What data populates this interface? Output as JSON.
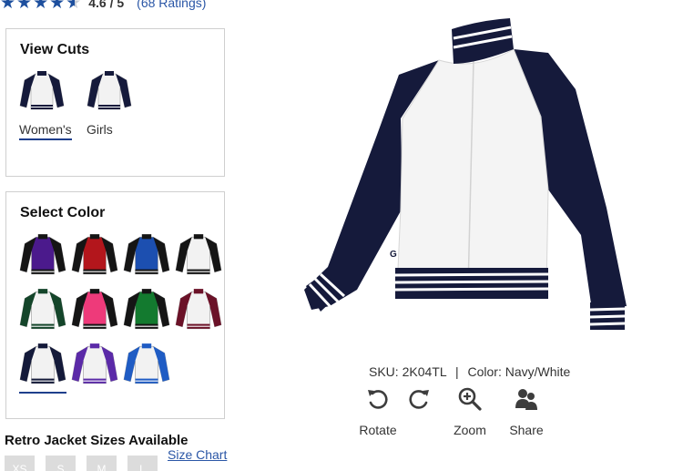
{
  "rating": {
    "stars_value": 4.6,
    "value_text": "4.6 / 5",
    "count_text": "(68 Ratings)",
    "star_color": "#1d4f9e"
  },
  "cuts": {
    "title": "View Cuts",
    "items": [
      {
        "label": "Women's",
        "selected": true
      },
      {
        "label": "Girls",
        "selected": false
      }
    ]
  },
  "colors": {
    "title": "Select Color",
    "swatches": [
      {
        "name": "Purple/Black",
        "body": "#4b1a8c",
        "sleeve": "#151515",
        "selected": false
      },
      {
        "name": "Red/Black",
        "body": "#b3161c",
        "sleeve": "#151515",
        "selected": false
      },
      {
        "name": "Royal/Black",
        "body": "#1c4fb0",
        "sleeve": "#151515",
        "selected": false
      },
      {
        "name": "White/Black",
        "body": "#f2f2f2",
        "sleeve": "#151515",
        "selected": false
      },
      {
        "name": "White/Forest",
        "body": "#f2f2f2",
        "sleeve": "#14452a",
        "selected": false
      },
      {
        "name": "Pink/Black",
        "body": "#ee3a7a",
        "sleeve": "#151515",
        "selected": false
      },
      {
        "name": "Kelly/Black",
        "body": "#137a2f",
        "sleeve": "#151515",
        "selected": false
      },
      {
        "name": "White/Maroon",
        "body": "#f2f2f2",
        "sleeve": "#6b1228",
        "selected": false
      },
      {
        "name": "White/Navy",
        "body": "#f2f2f2",
        "sleeve": "#141a3a",
        "selected": true
      },
      {
        "name": "White/Purple",
        "body": "#f2f2f2",
        "sleeve": "#5b2aa8",
        "selected": false
      },
      {
        "name": "White/Royal",
        "body": "#f2f2f2",
        "sleeve": "#1f5cc4",
        "selected": false
      }
    ]
  },
  "sizes": {
    "heading": "Retro Jacket Sizes Available",
    "size_chart_label": "Size Chart",
    "options": [
      "XS",
      "S",
      "M",
      "L"
    ]
  },
  "product": {
    "sku_label": "SKU:",
    "sku": "2K04TL",
    "separator": "|",
    "color_label": "Color:",
    "color": "Navy/White",
    "body_color": "#f4f4f4",
    "sleeve_color": "#151a3b"
  },
  "tools": [
    {
      "label": "Rotate",
      "icon": "rotate-left-icon"
    },
    {
      "label": "Zoom",
      "icon": "zoom-in-icon"
    },
    {
      "label": "Share",
      "icon": "share-people-icon"
    }
  ]
}
